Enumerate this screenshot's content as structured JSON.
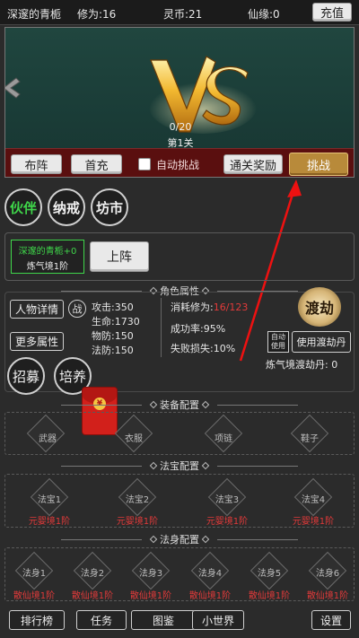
{
  "topbar": {
    "player_name": "深邃的青栀",
    "cultivation": "修为:16",
    "spirit_coins": "灵币:21",
    "fate": "仙缘:0",
    "recharge_label": "充值"
  },
  "battle": {
    "vs_text": "VS",
    "progress": "0/20",
    "stage": "第1关",
    "formation_label": "布阵",
    "first_charge_label": "首充",
    "auto_challenge_label": "自动挑战",
    "clear_reward_label": "通关奖励",
    "challenge_label": "挑战"
  },
  "tabs": {
    "partner": "伙伴",
    "ring": "纳戒",
    "market": "坊市"
  },
  "hero": {
    "name_card": "深邃的青栀+0",
    "realm_card": "炼气境1阶",
    "deploy_label": "上阵"
  },
  "attributes": {
    "section_title": "角色属性",
    "details_label": "人物详情",
    "battle_tag": "战",
    "more_label": "更多属性",
    "attack": "攻击:350",
    "hp": "生命:1730",
    "phys_def": "物防:150",
    "mag_def": "法防:150",
    "consume_label": "消耗修为:",
    "consume_value": "16/123",
    "success_rate": "成功率:95%",
    "fail_loss": "失败损失:10%",
    "tribulation_logo": "渡劫",
    "auto_use_line1": "自动",
    "auto_use_line2": "使用",
    "use_pill_label": "使用渡劫丹",
    "pill_count": "炼气境渡劫丹: 0",
    "recruit_label": "招募",
    "train_label": "培养"
  },
  "equipment": {
    "section_title": "装备配置",
    "slots": [
      "武器",
      "衣服",
      "项链",
      "鞋子"
    ]
  },
  "treasure": {
    "section_title": "法宝配置",
    "slots": [
      "法宝1",
      "法宝2",
      "法宝3",
      "法宝4"
    ],
    "requirement": "元婴境1阶"
  },
  "body": {
    "section_title": "法身配置",
    "slots": [
      "法身1",
      "法身2",
      "法身3",
      "法身4",
      "法身5",
      "法身6"
    ],
    "requirement": "散仙境1阶"
  },
  "bottom_nav": {
    "leaderboard": "排行榜",
    "tasks": "任务",
    "codex": "图鉴",
    "small_world": "小世界",
    "settings": "设置"
  },
  "colors": {
    "accent_gold": "#d8b36a",
    "partner_green": "#3fd64a",
    "requirement_red": "#e23a3a",
    "battle_bar": "#5a0f0f"
  }
}
